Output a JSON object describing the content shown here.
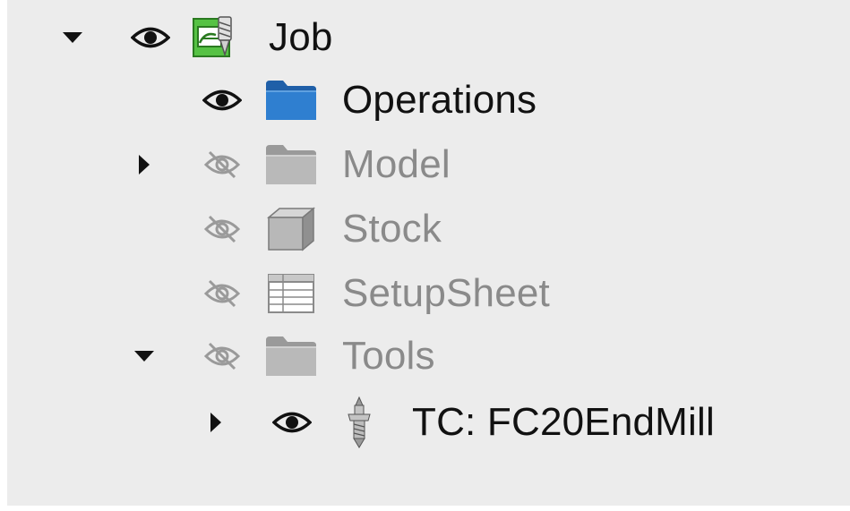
{
  "tree": {
    "items": [
      {
        "label": "Job",
        "expander": "expanded",
        "visibility": "visible",
        "icon": "job-icon"
      },
      {
        "label": "Operations",
        "expander": "none",
        "visibility": "visible",
        "icon": "folder-blue-icon"
      },
      {
        "label": "Model",
        "expander": "collapsed",
        "visibility": "hidden",
        "icon": "folder-gray-icon"
      },
      {
        "label": "Stock",
        "expander": "none",
        "visibility": "hidden",
        "icon": "cube-icon"
      },
      {
        "label": "SetupSheet",
        "expander": "none",
        "visibility": "hidden",
        "icon": "spreadsheet-icon"
      },
      {
        "label": "Tools",
        "expander": "expanded",
        "visibility": "hidden",
        "icon": "folder-gray-icon"
      },
      {
        "label": "TC: FC20EndMill",
        "expander": "collapsed",
        "visibility": "visible",
        "icon": "tool-bit-icon"
      }
    ]
  },
  "colors": {
    "panel_bg": "#ececec",
    "text_active": "#111111",
    "text_dim": "#8a8a8a",
    "folder_blue": "#2f7fd0",
    "folder_gray": "#b9b9b9",
    "job_green": "#47b03a"
  }
}
